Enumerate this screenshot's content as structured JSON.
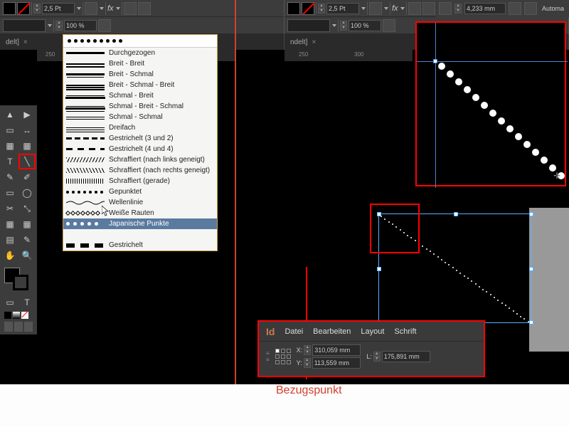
{
  "toolbar": {
    "stroke_weight": "2,5 Pt",
    "opacity": "100 %",
    "fx": "fx",
    "width_mm": "4,233 mm",
    "automa": "Automa"
  },
  "tabs": {
    "t1": "delt]",
    "t2": "ndelt]"
  },
  "ruler": {
    "m1": "250",
    "m2": "250",
    "m3": "300"
  },
  "dropdown": {
    "items": [
      {
        "label": "Durchgezogen",
        "style": "solid"
      },
      {
        "label": "Breit - Breit",
        "style": "tt"
      },
      {
        "label": "Breit - Schmal",
        "style": "ts"
      },
      {
        "label": "Breit - Schmal - Breit",
        "style": "tst"
      },
      {
        "label": "Schmal - Breit",
        "style": "st"
      },
      {
        "label": "Schmal - Breit - Schmal",
        "style": "sts"
      },
      {
        "label": "Schmal - Schmal",
        "style": "ss"
      },
      {
        "label": "Dreifach",
        "style": "triple"
      },
      {
        "label": "Gestrichelt (3 und 2)",
        "style": "dash32"
      },
      {
        "label": "Gestrichelt (4 und 4)",
        "style": "dash44"
      },
      {
        "label": "Schraffiert (nach links geneigt)",
        "style": "hatchl"
      },
      {
        "label": "Schraffiert (nach rechts geneigt)",
        "style": "hatchr"
      },
      {
        "label": "Schraffiert (gerade)",
        "style": "hatchv"
      },
      {
        "label": "Gepunktet",
        "style": "dots"
      },
      {
        "label": "Wellenlinie",
        "style": "wave"
      },
      {
        "label": "Weiße Rauten",
        "style": "diamonds"
      },
      {
        "label": "Japanische Punkte",
        "style": "jdots",
        "hover": true
      },
      {
        "label": "",
        "style": "blank"
      },
      {
        "label": "Gestrichelt",
        "style": "bigdash"
      }
    ]
  },
  "props": {
    "id": "Id",
    "menu": [
      "Datei",
      "Bearbeiten",
      "Layout",
      "Schrift"
    ],
    "x_label": "X:",
    "y_label": "Y:",
    "l_label": "L:",
    "x": "310,059 mm",
    "y": "113,559 mm",
    "l": "175,891 mm"
  },
  "annotation": {
    "bezugspunkt": "Bezugspunkt"
  }
}
